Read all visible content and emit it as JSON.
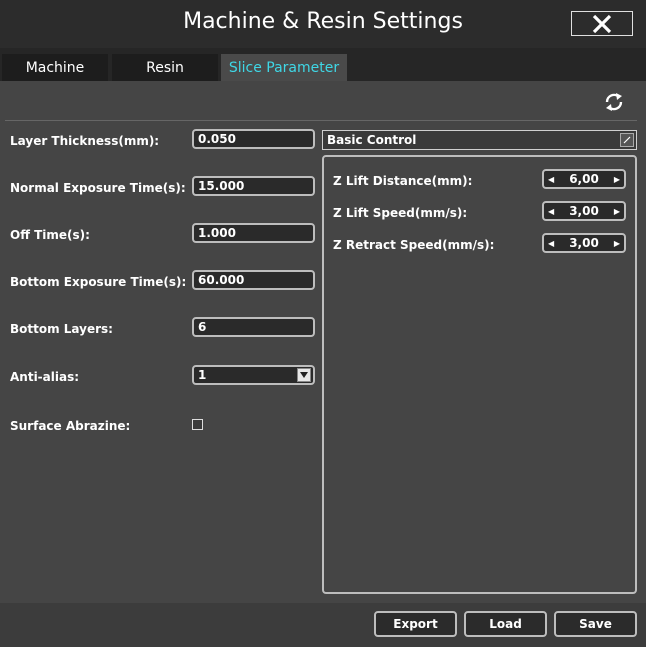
{
  "window": {
    "title": "Machine & Resin Settings"
  },
  "tabs": [
    {
      "label": "Machine"
    },
    {
      "label": "Resin"
    },
    {
      "label": "Slice Parameter"
    }
  ],
  "params": [
    {
      "label": "Layer Thickness(mm):",
      "value": "0.050"
    },
    {
      "label": "Normal Exposure Time(s):",
      "value": "15.000"
    },
    {
      "label": "Off Time(s):",
      "value": "1.000"
    },
    {
      "label": "Bottom Exposure Time(s):",
      "value": "60.000"
    },
    {
      "label": "Bottom Layers:",
      "value": "6"
    }
  ],
  "anti_alias": {
    "label": "Anti-alias:",
    "value": "1"
  },
  "surface": {
    "label": "Surface Abrazine:",
    "checked": false
  },
  "control_select": {
    "value": "Basic Control"
  },
  "basic_control": [
    {
      "label": "Z Lift Distance(mm):",
      "value": "6,00"
    },
    {
      "label": "Z Lift Speed(mm/s):",
      "value": "3,00"
    },
    {
      "label": "Z Retract Speed(mm/s):",
      "value": "3,00"
    }
  ],
  "footer": {
    "export_label": "Export",
    "load_label": "Load",
    "save_label": "Save"
  },
  "icons": {
    "close": "close-icon",
    "refresh": "refresh-icon"
  },
  "colors": {
    "active_tab_text": "#3fd7e6"
  }
}
